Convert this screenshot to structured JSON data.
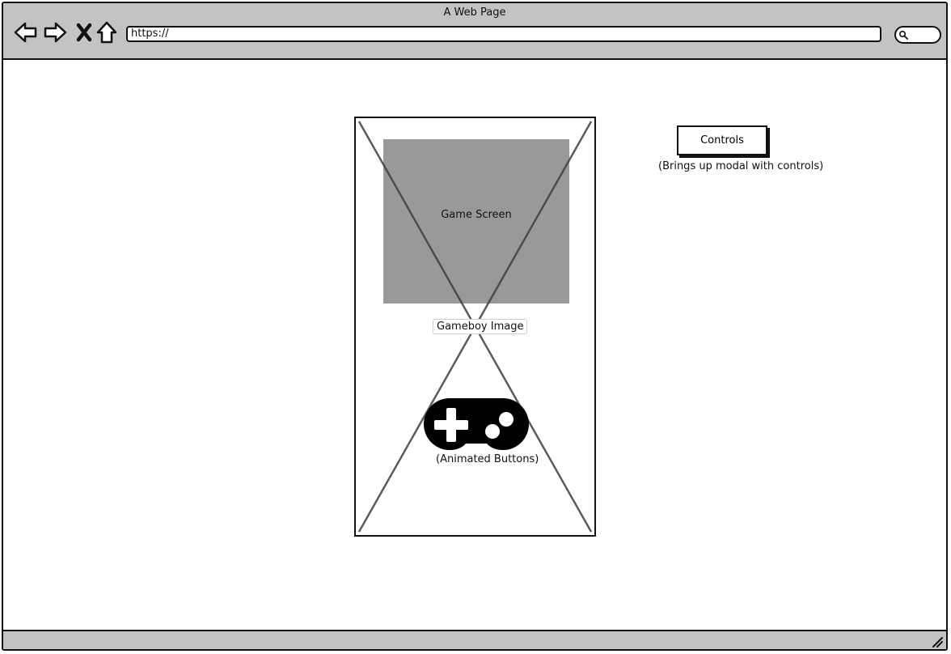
{
  "window": {
    "title": "A Web Page"
  },
  "navigation": {
    "back_icon": "arrow-left-icon",
    "forward_icon": "arrow-right-icon",
    "stop_icon": "close-icon",
    "home_icon": "home-icon"
  },
  "address_bar": {
    "value": "https://"
  },
  "search": {
    "icon": "search-icon"
  },
  "gameboy": {
    "screen_label": "Game Screen",
    "image_label": "Gameboy Image",
    "gamepad_icon": "gamepad-icon",
    "buttons_label": "(Animated Buttons)"
  },
  "controls": {
    "button_label": "Controls",
    "note": "(Brings up modal with controls)"
  },
  "colors": {
    "chrome": "#c3c3c3",
    "screen": "#999999",
    "ink": "#111111"
  }
}
